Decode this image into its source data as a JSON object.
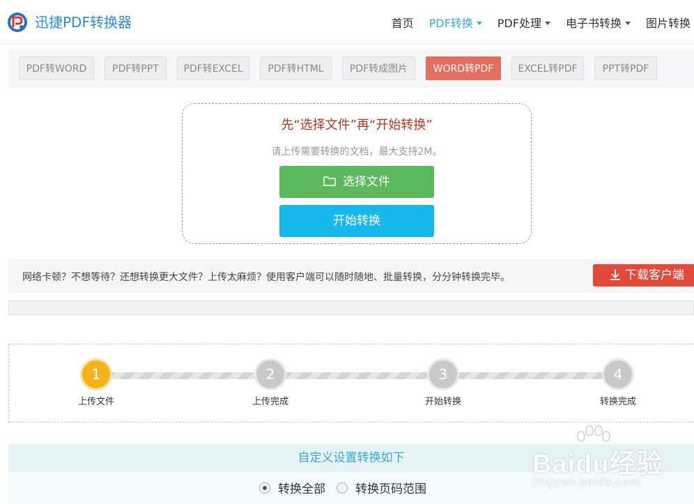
{
  "header": {
    "brand": "迅捷PDF转换器",
    "nav": [
      {
        "label": "首页",
        "active": false,
        "dropdown": false
      },
      {
        "label": "PDF转换",
        "active": true,
        "dropdown": true
      },
      {
        "label": "PDF处理",
        "active": false,
        "dropdown": true
      },
      {
        "label": "电子书转换",
        "active": false,
        "dropdown": true
      },
      {
        "label": "图片转换",
        "active": false,
        "dropdown": true
      }
    ]
  },
  "tabs": [
    {
      "label": "PDF转WORD",
      "active": false
    },
    {
      "label": "PDF转PPT",
      "active": false
    },
    {
      "label": "PDF转EXCEL",
      "active": false
    },
    {
      "label": "PDF转HTML",
      "active": false
    },
    {
      "label": "PDF转成图片",
      "active": false
    },
    {
      "label": "WORD转PDF",
      "active": true
    },
    {
      "label": "EXCEL转PDF",
      "active": false
    },
    {
      "label": "PPT转PDF",
      "active": false
    }
  ],
  "upload": {
    "title": "先“选择文件”再“开始转换”",
    "hint": "请上传需要转换的文档，最大支持2M。",
    "select_label": "选择文件",
    "start_label": "开始转换"
  },
  "notice": {
    "text": "网络卡顿？不想等待？还想转换更大文件？上传太麻烦？使用客户端可以随时随地、批量转换，分分钟转换完毕。",
    "download_label": "下载客户端"
  },
  "progress": {
    "percent": 0
  },
  "steps": [
    {
      "number": "1",
      "label": "上传文件",
      "active": true
    },
    {
      "number": "2",
      "label": "上传完成",
      "active": false
    },
    {
      "number": "3",
      "label": "开始转换",
      "active": false
    },
    {
      "number": "4",
      "label": "转换完成",
      "active": false
    }
  ],
  "custom": {
    "title": "自定义设置转换如下",
    "options": [
      {
        "label": "转换全部",
        "checked": true
      },
      {
        "label": "转换页码范围",
        "checked": false
      }
    ]
  },
  "watermark": {
    "text": "Baidu经验",
    "url": "jingyan.baidu.com"
  },
  "colors": {
    "accent": "#3aa7d8",
    "active_tab": "#e66e5e",
    "select_button": "#5cb85c",
    "start_button": "#17b9ec",
    "download_button": "#e14a3a",
    "active_step": "#f5b21b"
  }
}
